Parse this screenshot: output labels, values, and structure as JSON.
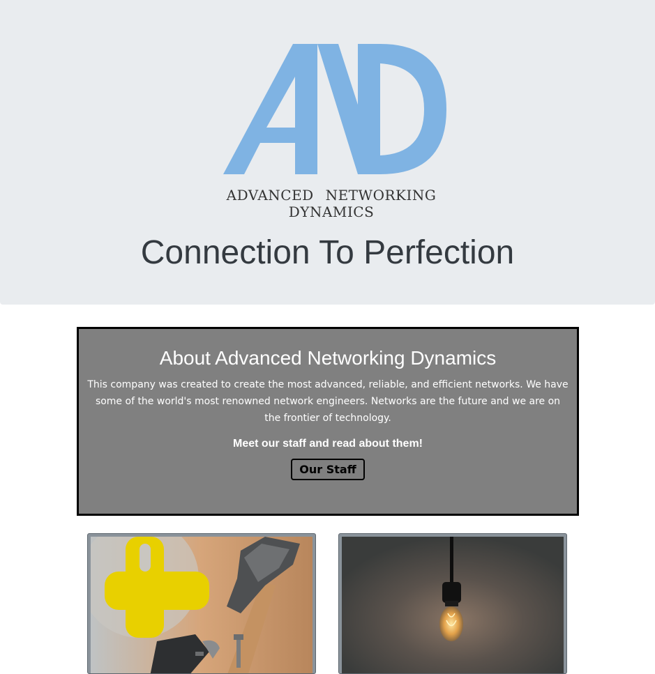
{
  "header": {
    "logo": {
      "monogram": "AND",
      "name": "ADVANCED NETWORKING DYNAMICS",
      "color": "#7fb3e3"
    },
    "tagline": "Connection To Perfection",
    "background": "#e9ecef"
  },
  "about": {
    "title": "About Advanced Networking Dynamics",
    "description": "This company was created to create the most advanced, reliable, and efficient networks. We have some of the world's most renowned network engineers. Networks are the future and we are on the frontier of technology.",
    "cta_text": "Meet our staff and read about them!",
    "button_label": "Our Staff",
    "background": "#808080"
  },
  "cards": [
    {
      "image": "tools-hammer-wrench-image"
    },
    {
      "image": "light-bulb-image"
    }
  ]
}
